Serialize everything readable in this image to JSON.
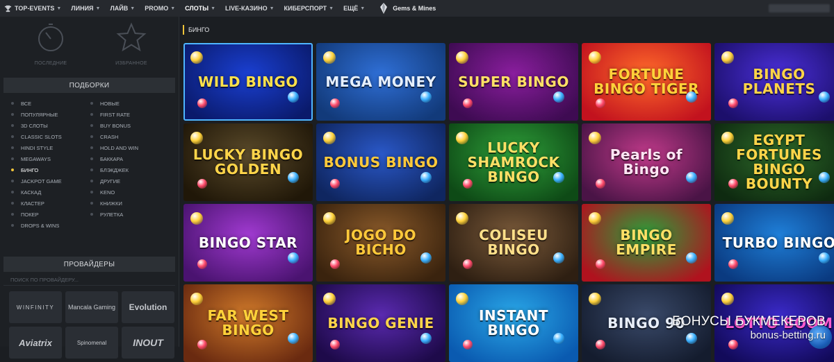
{
  "nav": {
    "items": [
      {
        "label": "TOP-EVENTS",
        "caret": true
      },
      {
        "label": "ЛИНИЯ",
        "caret": true
      },
      {
        "label": "ЛАЙВ",
        "caret": true
      },
      {
        "label": "PROMO",
        "caret": true
      },
      {
        "label": "СЛОТЫ",
        "caret": true
      },
      {
        "label": "LIVE-КАЗИНО",
        "caret": true
      },
      {
        "label": "КИБЕРСПОРТ",
        "caret": true
      },
      {
        "label": "ЕЩЁ",
        "caret": true
      }
    ],
    "gems_label": "Gems & Mines",
    "icons": {
      "trophy": "trophy-icon",
      "gem": "gem-icon",
      "caret": "chevron-down-icon"
    }
  },
  "sidebar": {
    "recent_label": "ПОСЛЕДНИЕ",
    "favorites_label": "ИЗБРАННОЕ",
    "collections_title": "ПОДБОРКИ",
    "collections_left": [
      "ВСЕ",
      "ПОПУЛЯРНЫЕ",
      "3D СЛОТЫ",
      "CLASSIC SLOTS",
      "HINDI STYLE",
      "MEGAWAYS",
      "БИНГО",
      "JACKPOT GAME",
      "КАСКАД",
      "КЛАСТЕР",
      "ПОКЕР",
      "DROPS & WINS"
    ],
    "collections_right": [
      "НОВЫЕ",
      "FIRST RATE",
      "BUY BONUS",
      "CRASH",
      "HOLD AND WIN",
      "БАККАРА",
      "БЛЭКДЖЕК",
      "ДРУГИЕ",
      "KENO",
      "КНИЖКИ",
      "РУЛЕТКА"
    ],
    "active_collection": "БИНГО",
    "providers_title": "ПРОВАЙДЕРЫ",
    "providers_search_placeholder": "ПОИСК ПО ПРОВАЙДЕРУ...",
    "providers": [
      "WINFINITY",
      "Mancala Gaming",
      "Evolution",
      "Aviatrix",
      "Spinomenal",
      "INOUT"
    ]
  },
  "main": {
    "title": "БИНГО",
    "games": [
      {
        "name": "WILD BINGO",
        "bg1": "#1a3fd1",
        "bg2": "#0a1a6b",
        "fg": "#ffe14a"
      },
      {
        "name": "MEGA MONEY",
        "bg1": "#2f6fd6",
        "bg2": "#123a7a",
        "fg": "#e6f0ff"
      },
      {
        "name": "SUPER BINGO",
        "bg1": "#8a1e9e",
        "bg2": "#3e0b52",
        "fg": "#ffe066"
      },
      {
        "name": "FORTUNE BINGO TIGER",
        "bg1": "#ff6a2a",
        "bg2": "#c2121e",
        "fg": "#ffd23a"
      },
      {
        "name": "BINGO PLANETS",
        "bg1": "#4a2fd8",
        "bg2": "#1c0f6b",
        "fg": "#ffd447"
      },
      {
        "name": "LUCKY BINGO GOLDEN",
        "bg1": "#5a4a2a",
        "bg2": "#201708",
        "fg": "#ffd54a"
      },
      {
        "name": "BONUS BINGO",
        "bg1": "#2a58c8",
        "bg2": "#0f2660",
        "fg": "#ffc93a"
      },
      {
        "name": "LUCKY SHAMROCK BINGO",
        "bg1": "#2fa03a",
        "bg2": "#0e4a16",
        "fg": "#ffe066"
      },
      {
        "name": "Pearls of Bingo",
        "bg1": "#c03a8a",
        "bg2": "#4a1446",
        "fg": "#ffe6f4"
      },
      {
        "name": "EGYPT FORTUNES BINGO BOUNTY",
        "bg1": "#2e6a2a",
        "bg2": "#0e2a10",
        "fg": "#ffd54a"
      },
      {
        "name": "BINGO STAR",
        "bg1": "#a03ad0",
        "bg2": "#4a1370",
        "fg": "#ffffff"
      },
      {
        "name": "JOGO DO BICHO",
        "bg1": "#8a5a2a",
        "bg2": "#3a230e",
        "fg": "#ffc93a"
      },
      {
        "name": "COLISEU BINGO",
        "bg1": "#7a5a3a",
        "bg2": "#2e1f12",
        "fg": "#ffe08a"
      },
      {
        "name": "BINGO EMPIRE",
        "bg1": "#2aa03a",
        "bg2": "#b0121e",
        "fg": "#ffe066"
      },
      {
        "name": "TURBO BINGO",
        "bg1": "#1f7fd8",
        "bg2": "#0a3a80",
        "fg": "#ffffff"
      },
      {
        "name": "FAR WEST BINGO",
        "bg1": "#d07a2a",
        "bg2": "#6a2a10",
        "fg": "#ffd23a"
      },
      {
        "name": "BINGO GENIE",
        "bg1": "#5a2ab0",
        "bg2": "#1e0a4a",
        "fg": "#ffd54a"
      },
      {
        "name": "INSTANT BINGO",
        "bg1": "#2aa8e8",
        "bg2": "#0a5ab0",
        "fg": "#ffffff"
      },
      {
        "name": "BINGO 90",
        "bg1": "#3a4a6a",
        "bg2": "#141c2e",
        "fg": "#e8eef8"
      },
      {
        "name": "LOTTO BOOM",
        "bg1": "#3a2ac8",
        "bg2": "#120a5a",
        "fg": "#ff5ad0"
      }
    ]
  },
  "watermark": {
    "line1": "БОНУСЫ БУКМЕКЕРОВ",
    "line2": "bonus-betting.ru"
  }
}
